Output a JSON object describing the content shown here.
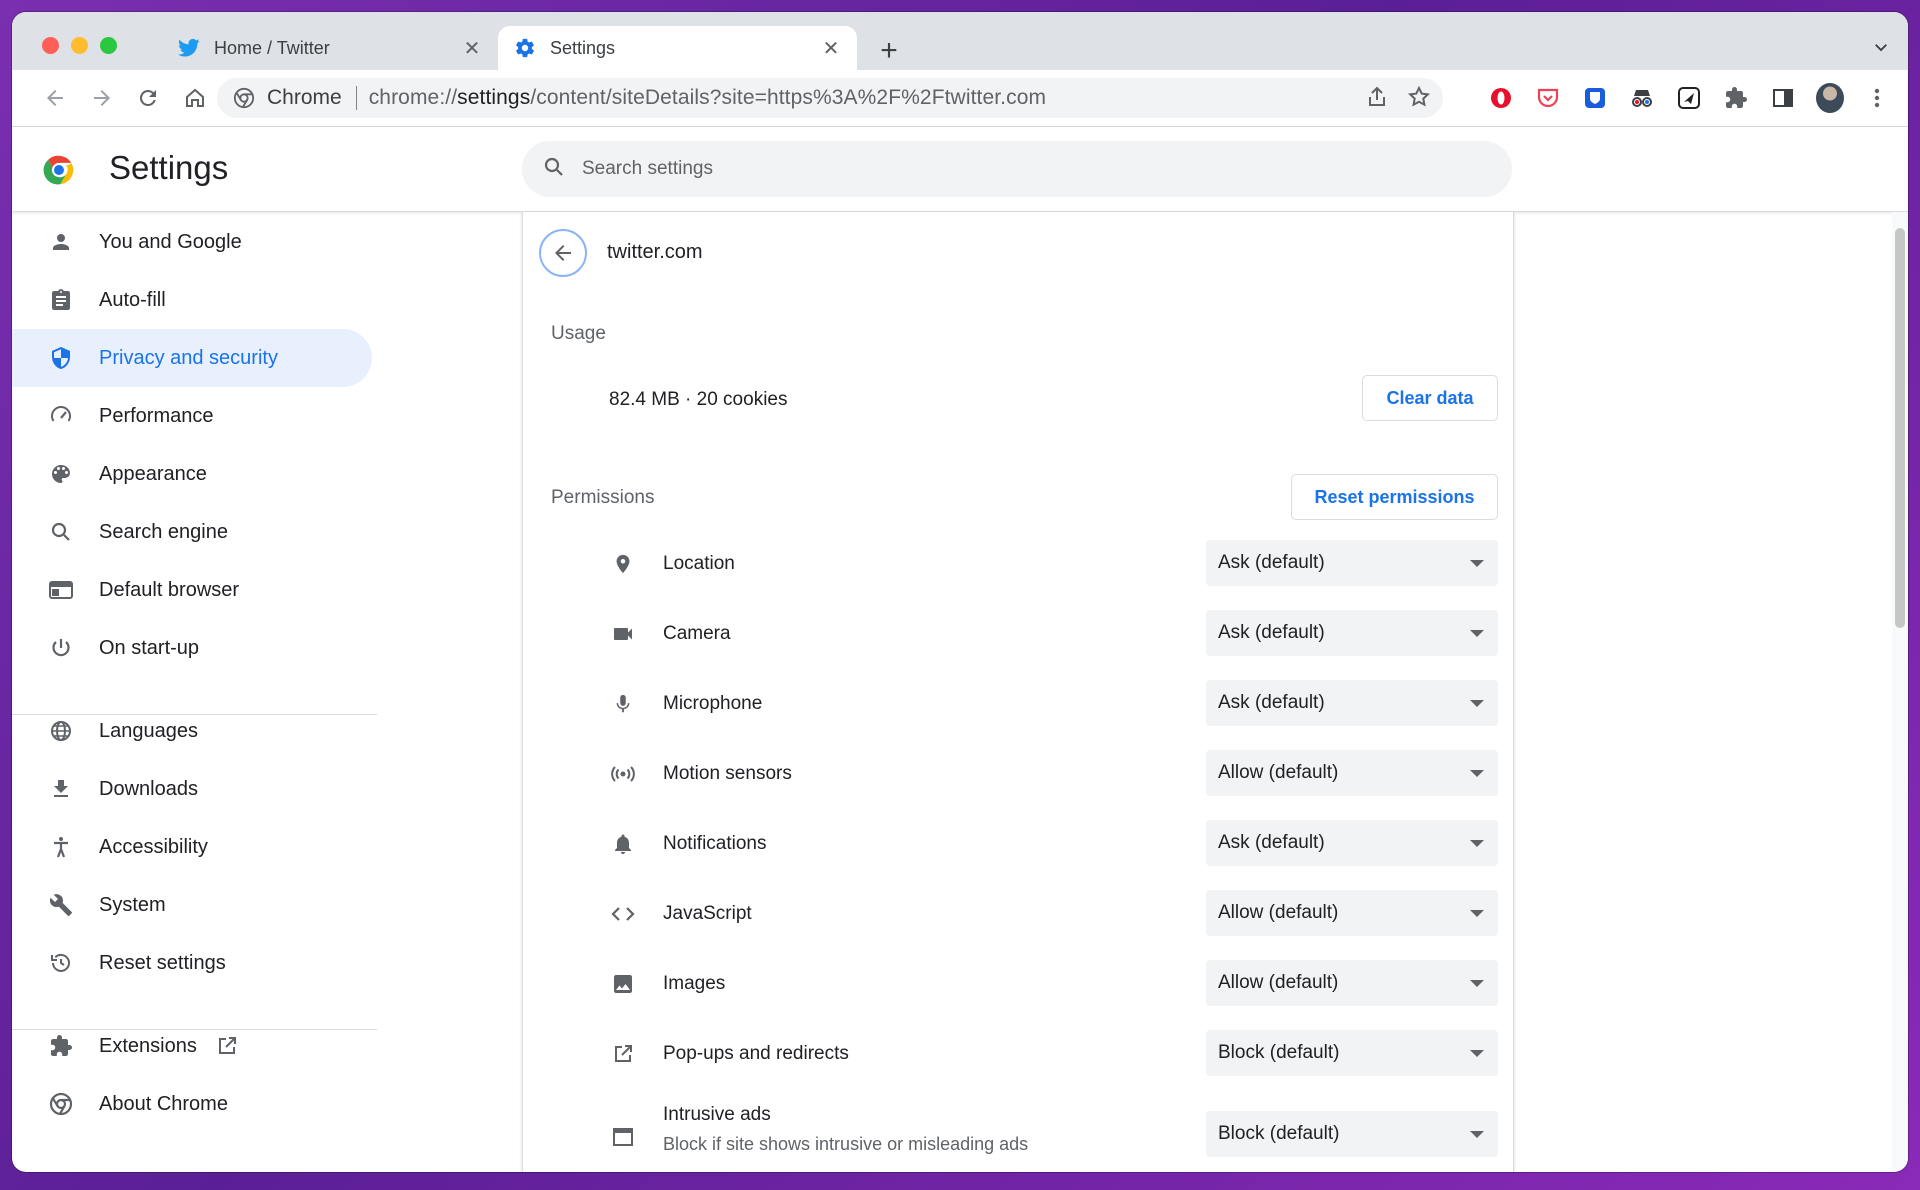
{
  "tabs": [
    {
      "label": "Home / Twitter",
      "icon": "twitter-icon",
      "active": false
    },
    {
      "label": "Settings",
      "icon": "gear-icon",
      "active": true
    }
  ],
  "omnibox": {
    "site_label": "Chrome",
    "url_prefix": "chrome://",
    "url_host": "settings",
    "url_path": "/content/siteDetails?site=https%3A%2F%2Ftwitter.com"
  },
  "header": {
    "title": "Settings",
    "search_placeholder": "Search settings"
  },
  "sidebar": {
    "items": [
      {
        "label": "You and Google",
        "icon": "person-icon"
      },
      {
        "label": "Auto-fill",
        "icon": "clipboard-icon"
      },
      {
        "label": "Privacy and security",
        "icon": "shield-icon",
        "selected": true
      },
      {
        "label": "Performance",
        "icon": "speedometer-icon"
      },
      {
        "label": "Appearance",
        "icon": "palette-icon"
      },
      {
        "label": "Search engine",
        "icon": "search-icon"
      },
      {
        "label": "Default browser",
        "icon": "browser-window-icon"
      },
      {
        "label": "On start-up",
        "icon": "power-icon"
      },
      {
        "label": "Languages",
        "icon": "globe-icon"
      },
      {
        "label": "Downloads",
        "icon": "download-icon"
      },
      {
        "label": "Accessibility",
        "icon": "accessibility-icon"
      },
      {
        "label": "System",
        "icon": "wrench-icon"
      },
      {
        "label": "Reset settings",
        "icon": "history-icon"
      },
      {
        "label": "Extensions",
        "icon": "puzzle-icon"
      },
      {
        "label": "About Chrome",
        "icon": "chrome-icon"
      }
    ]
  },
  "site": {
    "name": "twitter.com",
    "usage_label": "Usage",
    "usage_value": "82.4 MB · 20 cookies",
    "clear_data": "Clear data",
    "permissions_label": "Permissions",
    "reset_permissions": "Reset permissions"
  },
  "permissions": [
    {
      "label": "Location",
      "value": "Ask (default)",
      "icon": "location-pin-icon"
    },
    {
      "label": "Camera",
      "value": "Ask (default)",
      "icon": "camera-icon"
    },
    {
      "label": "Microphone",
      "value": "Ask (default)",
      "icon": "microphone-icon"
    },
    {
      "label": "Motion sensors",
      "value": "Allow (default)",
      "icon": "motion-sensor-icon"
    },
    {
      "label": "Notifications",
      "value": "Ask (default)",
      "icon": "bell-icon"
    },
    {
      "label": "JavaScript",
      "value": "Allow (default)",
      "icon": "code-icon"
    },
    {
      "label": "Images",
      "value": "Allow (default)",
      "icon": "image-icon"
    },
    {
      "label": "Pop-ups and redirects",
      "value": "Block (default)",
      "icon": "open-in-new-icon"
    },
    {
      "label": "Intrusive ads",
      "sublabel": "Block if site shows intrusive or misleading ads",
      "value": "Block (default)",
      "icon": "ad-window-icon"
    }
  ]
}
